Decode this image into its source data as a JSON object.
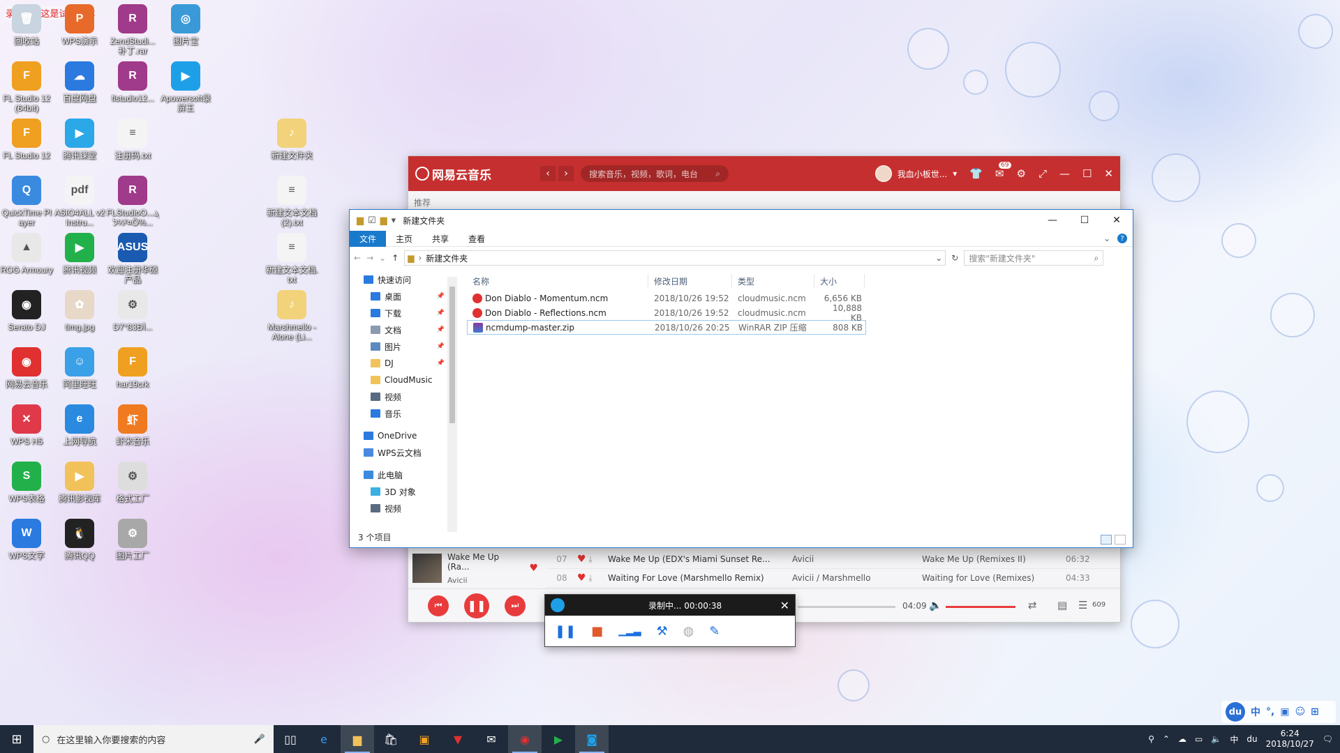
{
  "desktop": {
    "trial_banner": "录屏王 · 这是试用版本",
    "icons": [
      {
        "label": "回收站",
        "color": "#c8d4e0",
        "glyph": "🗑"
      },
      {
        "label": "WPS演示",
        "color": "#e86a2a",
        "glyph": "P"
      },
      {
        "label": "ZendStudi...补丁.rar",
        "color": "#a03a8a",
        "glyph": "R"
      },
      {
        "label": "图片宝",
        "color": "#3a9ad8",
        "glyph": "◎"
      },
      {
        "label": "FL Studio 12 (64bit)",
        "color": "#f0a020",
        "glyph": "F"
      },
      {
        "label": "百度网盘",
        "color": "#2a7ae0",
        "glyph": "☁"
      },
      {
        "label": "flstudio12...",
        "color": "#a03a8a",
        "glyph": "R"
      },
      {
        "label": "Apowersoft录屏王",
        "color": "#1ea0e8",
        "glyph": "▶"
      },
      {
        "label": "FL Studio 12",
        "color": "#f0a020",
        "glyph": "F"
      },
      {
        "label": "腾讯课堂",
        "color": "#2aa8e8",
        "glyph": "▶"
      },
      {
        "label": "注册码.txt",
        "color": "#f4f4f4",
        "glyph": "≡"
      },
      {
        "label": "新建文件夹",
        "color": "#f2d27a",
        "glyph": "♪"
      },
      {
        "label": "QuickTime Player",
        "color": "#3a8ae0",
        "glyph": "Q"
      },
      {
        "label": "ASIO4ALL v2 Instru...",
        "color": "#f4f4f4",
        "glyph": "pdf"
      },
      {
        "label": "FLStudioO...ܔ²¼ל¤Ô%...",
        "color": "#a03a8a",
        "glyph": "R"
      },
      {
        "label": "新建文本文档 (2).txt",
        "color": "#f4f4f4",
        "glyph": "≡"
      },
      {
        "label": "ROG Armoury",
        "color": "#e8e8e8",
        "glyph": "▲"
      },
      {
        "label": "腾讯视频",
        "color": "#22b04a",
        "glyph": "▶"
      },
      {
        "label": "欢迎注册华硕产品",
        "color": "#1a5ab0",
        "glyph": "ASUS"
      },
      {
        "label": "新建文本文档.txt",
        "color": "#f4f4f4",
        "glyph": "≡"
      },
      {
        "label": "Serato DJ",
        "color": "#222222",
        "glyph": "◉"
      },
      {
        "label": "timg.jpg",
        "color": "#e8d8c8",
        "glyph": "✿"
      },
      {
        "label": "D7°ß3ĐÌ...",
        "color": "#e8e8e8",
        "glyph": "⚙"
      },
      {
        "label": "Marshmello - Alone (Li...",
        "color": "#f2d27a",
        "glyph": "♪"
      },
      {
        "label": "网易云音乐",
        "color": "#e03030",
        "glyph": "◉"
      },
      {
        "label": "阿里旺旺",
        "color": "#3aa0e8",
        "glyph": "☺"
      },
      {
        "label": "har19crk",
        "color": "#f0a020",
        "glyph": "F"
      },
      {
        "label": "WPS H5",
        "color": "#e03a4a",
        "glyph": "✕"
      },
      {
        "label": "上网导航",
        "color": "#2a8ae0",
        "glyph": "e"
      },
      {
        "label": "虾米音乐",
        "color": "#f07a20",
        "glyph": "虾"
      },
      {
        "label": "WPS表格",
        "color": "#22b04a",
        "glyph": "S"
      },
      {
        "label": "腾讯影视库",
        "color": "#f2c25a",
        "glyph": "▶"
      },
      {
        "label": "格式工厂",
        "color": "#dddddd",
        "glyph": "⚙"
      },
      {
        "label": "WPS文字",
        "color": "#2a7ae0",
        "glyph": "W"
      },
      {
        "label": "腾讯QQ",
        "color": "#222222",
        "glyph": "🐧"
      },
      {
        "label": "图片工厂",
        "color": "#a8a8a8",
        "glyph": "⚙"
      }
    ]
  },
  "music_app": {
    "logo": "网易云音乐",
    "nav_back": "‹",
    "nav_forward": "›",
    "search_placeholder": "搜索音乐，视频，歌词，电台",
    "username": "我血小板世...",
    "mail_badge": "69",
    "sidebar_label": "推荐",
    "now_playing_title": "Wake Me Up (Ra...",
    "now_playing_artist": "Avicii",
    "tracks": [
      {
        "num": "07",
        "title": "Wake Me Up (EDX's Miami Sunset Re...",
        "artist": "Avicii",
        "album": "Wake Me Up (Remixes II)",
        "dur": "06:32"
      },
      {
        "num": "08",
        "title": "Waiting For Love (Marshmello Remix)",
        "artist": "Avicii / Marshmello",
        "album": "Waiting for Love (Remixes)",
        "dur": "04:33"
      }
    ],
    "time_total": "04:09",
    "playlist_count": "609",
    "volume_percent": 100
  },
  "explorer": {
    "title": "新建文件夹",
    "tabs": [
      "文件",
      "主页",
      "共享",
      "查看"
    ],
    "address": "新建文件夹",
    "search_placeholder": "搜索\"新建文件夹\"",
    "nav": [
      {
        "label": "快速访问",
        "color": "#2a7ae0",
        "pinned": false,
        "indent": 0
      },
      {
        "label": "桌面",
        "color": "#2a7ae0",
        "pinned": true,
        "indent": 1
      },
      {
        "label": "下载",
        "color": "#2a7ae0",
        "pinned": true,
        "indent": 1
      },
      {
        "label": "文档",
        "color": "#8a9ab0",
        "pinned": true,
        "indent": 1
      },
      {
        "label": "图片",
        "color": "#5a8ac0",
        "pinned": true,
        "indent": 1
      },
      {
        "label": "DJ",
        "color": "#f2c25a",
        "pinned": true,
        "indent": 1
      },
      {
        "label": "CloudMusic",
        "color": "#f2c25a",
        "pinned": false,
        "indent": 1
      },
      {
        "label": "视频",
        "color": "#5a6a80",
        "pinned": false,
        "indent": 1
      },
      {
        "label": "音乐",
        "color": "#2a7ae0",
        "pinned": false,
        "indent": 1
      },
      {
        "label": "OneDrive",
        "color": "#2a7ae0",
        "pinned": false,
        "indent": 0
      },
      {
        "label": "WPS云文档",
        "color": "#4a8ae0",
        "pinned": false,
        "indent": 0
      },
      {
        "label": "此电脑",
        "color": "#3a8ae0",
        "pinned": false,
        "indent": 0
      },
      {
        "label": "3D 对象",
        "color": "#3ab0e0",
        "pinned": false,
        "indent": 1
      },
      {
        "label": "视频",
        "color": "#5a6a80",
        "pinned": false,
        "indent": 1
      }
    ],
    "columns": [
      "名称",
      "修改日期",
      "类型",
      "大小"
    ],
    "files": [
      {
        "name": "Don Diablo - Momentum.ncm",
        "date": "2018/10/26 19:52",
        "type": "cloudmusic.ncm",
        "size": "6,656 KB",
        "kind": "ncm"
      },
      {
        "name": "Don Diablo - Reflections.ncm",
        "date": "2018/10/26 19:52",
        "type": "cloudmusic.ncm",
        "size": "10,888 KB",
        "kind": "ncm"
      },
      {
        "name": "ncmdump-master.zip",
        "date": "2018/10/26 20:25",
        "type": "WinRAR ZIP 压缩",
        "size": "808 KB",
        "kind": "zip"
      }
    ],
    "status": "3 个项目"
  },
  "recorder": {
    "status": "录制中... 00:00:38"
  },
  "taskbar": {
    "search_placeholder": "在这里输入你要搜索的内容",
    "ime": "中",
    "time": "6:24",
    "date": "2018/10/27"
  }
}
